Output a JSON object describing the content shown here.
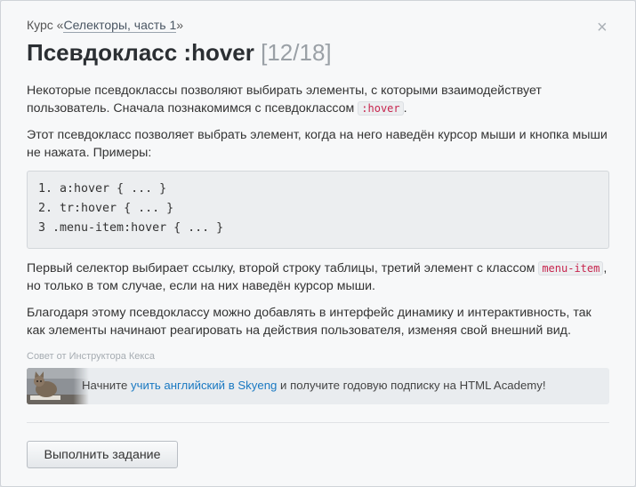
{
  "breadcrumb": {
    "prefix": "Курс «",
    "course_link": "Селекторы, часть 1",
    "suffix": "»"
  },
  "close_glyph": "×",
  "title": {
    "text": "Псевдокласс :hover",
    "counter": "[12/18]"
  },
  "content": {
    "p1_before": "Некоторые псевдоклассы позволяют выбирать элементы, с которыми взаимодействует пользователь. Сначала познакомимся с псевдоклассом ",
    "p1_code": ":hover",
    "p1_after": ".",
    "p2": "Этот псевдокласс позволяет выбрать элемент, когда на него наведён курсор мыши и кнопка мыши не нажата. Примеры:",
    "code_lines": [
      "1. a:hover { ... }",
      "2. tr:hover { ... }",
      "3 .menu-item:hover { ... }"
    ],
    "p3_before": "Первый селектор выбирает ссылку, второй строку таблицы, третий элемент с классом ",
    "p3_code": "menu-item",
    "p3_after": ", но только в том случае, если на них наведён курсор мыши.",
    "p4": "Благодаря этому псевдоклассу можно добавлять в интерфейс динамику и интерактивность, так как элементы начинают реагировать на действия пользователя, изменяя свой внешний вид."
  },
  "tip": {
    "label": "Совет от Инструктора Кекса",
    "before": "Начните ",
    "link": "учить английский в Skyeng",
    "after": " и получите годовую подписку на HTML Academy!"
  },
  "button": {
    "label": "Выполнить задание"
  },
  "colors": {
    "link": "#1a79c2",
    "inline_code": "#c7254e",
    "background": "#f7f8f9"
  }
}
